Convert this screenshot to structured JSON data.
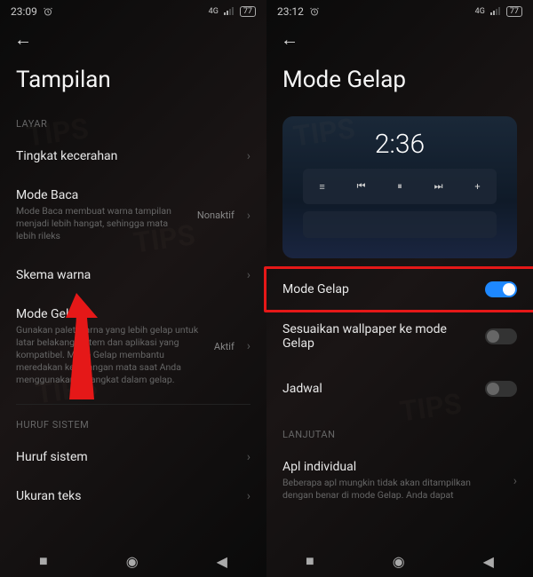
{
  "left": {
    "statusbar": {
      "time": "23:09",
      "battery": "77"
    },
    "title": "Tampilan",
    "sections": {
      "layar": {
        "header": "LAYAR",
        "brightness": "Tingkat kecerahan",
        "readmode": {
          "title": "Mode Baca",
          "desc": "Mode Baca membuat warna tampilan menjadi lebih hangat, sehingga mata lebih rileks",
          "status": "Nonaktif"
        },
        "colorscheme": "Skema warna",
        "darkmode": {
          "title": "Mode Gelap",
          "desc": "Gunakan palet warna yang lebih gelap untuk latar belakang sistem dan aplikasi yang kompatibel. Mode Gelap membantu meredakan ketegangan mata saat Anda menggunakan perangkat dalam gelap.",
          "status": "Aktif"
        }
      },
      "fonts": {
        "header": "HURUF SISTEM",
        "systemfont": "Huruf sistem",
        "textsize": "Ukuran teks"
      }
    }
  },
  "right": {
    "statusbar": {
      "time": "23:12",
      "battery": "77"
    },
    "title": "Mode Gelap",
    "preview": {
      "clock": "2:36",
      "media_glyphs": {
        "menu": "≡",
        "prev": "⏮",
        "pause": "⏸",
        "next": "⏭",
        "add": "+"
      }
    },
    "items": {
      "darkmode": {
        "title": "Mode Gelap",
        "on": true
      },
      "wallpaper": {
        "title": "Sesuaikan wallpaper ke mode Gelap",
        "on": false
      },
      "schedule": {
        "title": "Jadwal",
        "on": false
      }
    },
    "advanced": {
      "header": "LANJUTAN",
      "individual": {
        "title": "Apl individual",
        "desc": "Beberapa apl mungkin tidak akan ditampilkan dengan benar di mode Gelap. Anda dapat"
      }
    }
  },
  "watermark": "TIPS"
}
